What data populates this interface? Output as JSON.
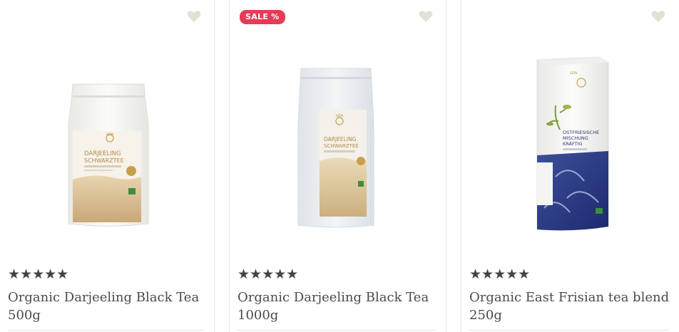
{
  "products": [
    {
      "rating_text": "★★★★★",
      "rating": 5,
      "title": "Organic Darjeeling Black Tea 500g",
      "badge": "",
      "pack_brand": "GEPA",
      "pack_line1": "DARJEELING",
      "pack_line2": "SCHWARZTEE",
      "wishlist_icon": "heart-icon"
    },
    {
      "rating_text": "★★★★★",
      "rating": 5,
      "title": "Organic Darjeeling Black Tea 1000g",
      "badge": "SALE %",
      "pack_brand": "GEPA",
      "pack_line1": "DARJEELING",
      "pack_line2": "SCHWARZTEE",
      "wishlist_icon": "heart-icon"
    },
    {
      "rating_text": "★★★★★",
      "rating": 5,
      "title": "Organic East Frisian tea blend 250g",
      "badge": "",
      "pack_brand": "GEPA",
      "pack_line1": "OSTFRIESISCHE",
      "pack_line2": "MISCHUNG",
      "pack_line3": "KRÄFTIG",
      "wishlist_icon": "heart-icon"
    }
  ],
  "colors": {
    "sale_badge": "#e23d57",
    "heart": "#e3e1d6",
    "text": "#444444",
    "divider": "#e6e6e6"
  }
}
